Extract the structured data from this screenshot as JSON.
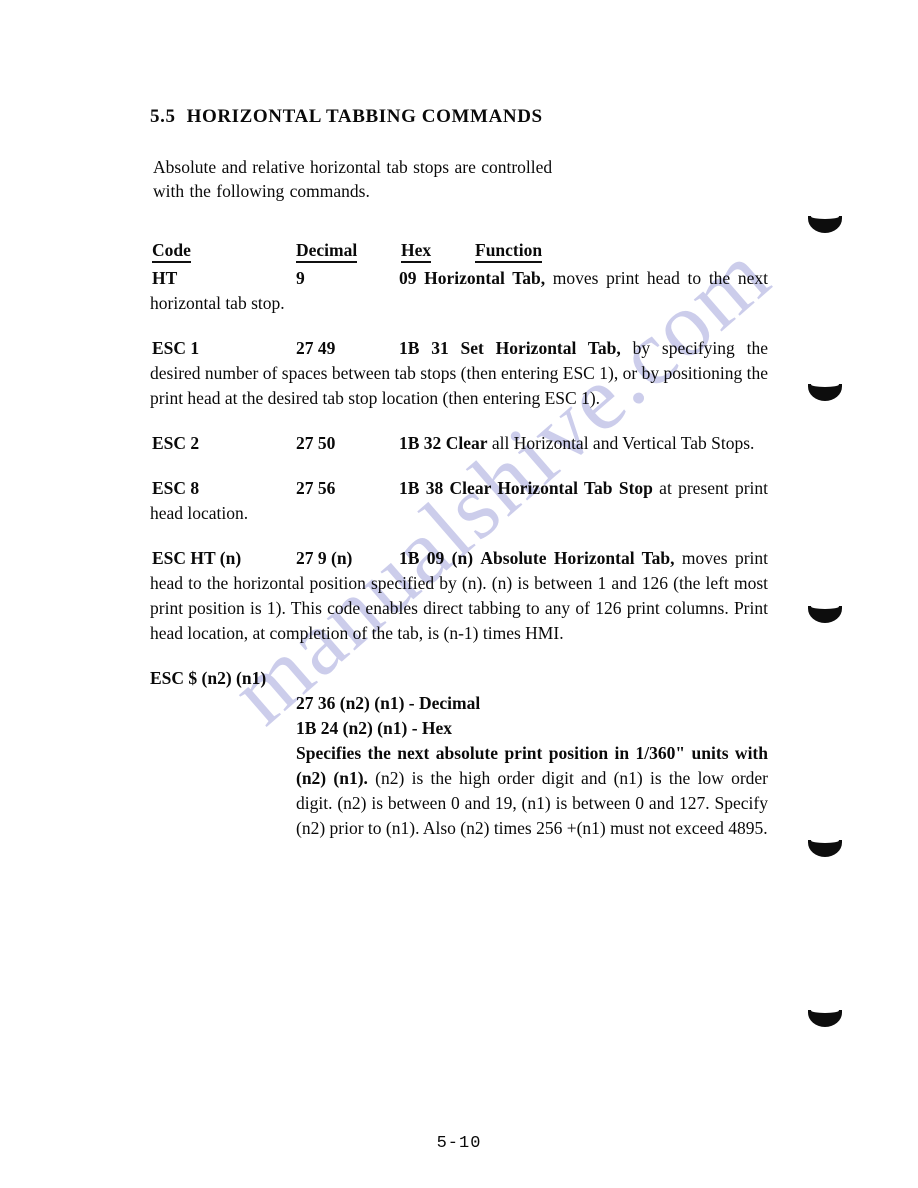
{
  "page": {
    "folio": "5-10",
    "watermark": "manualshive.com"
  },
  "heading": {
    "number": "5.5",
    "title": "HORIZONTAL TABBING COMMANDS"
  },
  "intro": {
    "line1": "Absolute and relative horizontal tab stops are controlled",
    "line2": "with the following commands."
  },
  "table": {
    "headers": {
      "code": "Code",
      "decimal": "Decimal",
      "hex": "Hex",
      "function": "Function"
    },
    "rows": [
      {
        "code": "HT",
        "decimal": "9",
        "hex": "09",
        "function_bold": "Horizontal   Tab,",
        "function_rest": " moves print head to the next horizontal tab stop."
      },
      {
        "code": "ESC 1",
        "decimal": "27 49",
        "hex": "1B 31",
        "function_bold": "Set   Horizontal   Tab,",
        "function_rest": " by specifying the desired number of spaces between tab stops (then entering ESC 1), or by positioning the print head at the desired tab stop location (then entering ESC 1)."
      },
      {
        "code": "ESC 2",
        "decimal": "27 50",
        "hex": "1B 32",
        "function_bold": "Clear",
        "function_rest": " all Horizontal and Vertical Tab Stops."
      },
      {
        "code": "ESC 8",
        "decimal": "27 56",
        "hex": "1B 38",
        "function_bold": "Clear Horizontal Tab Stop",
        "function_rest": " at present print head location."
      },
      {
        "code": "ESC HT (n)",
        "decimal": "27 9 (n)",
        "hex": "1B 09 (n)",
        "function_bold": "Absolute     Horizontal Tab,",
        "function_rest": " moves print head to the horizontal position specified by (n).  (n) is between 1 and 126 (the left most print position is 1).  This code enables direct tabbing to any of 126 print columns.  Print head location, at completion of the tab, is (n-1) times HMI."
      }
    ],
    "block_row": {
      "code": "ESC $ (n2) (n1)",
      "decimal_line": "27 36 (n2) (n1)  - Decimal",
      "hex_line": "1B 24 (n2) (n1)  - Hex",
      "desc_bold": "Specifies the next absolute print position in 1/360\" units with (n2) (n1).",
      "desc_rest": "  (n2) is the high order digit and (n1) is the low order digit.  (n2) is between 0 and 19, (n1) is between 0 and 127.  Specify (n2) prior to (n1).  Also (n2) times 256 +(n1) must not exceed 4895."
    }
  }
}
